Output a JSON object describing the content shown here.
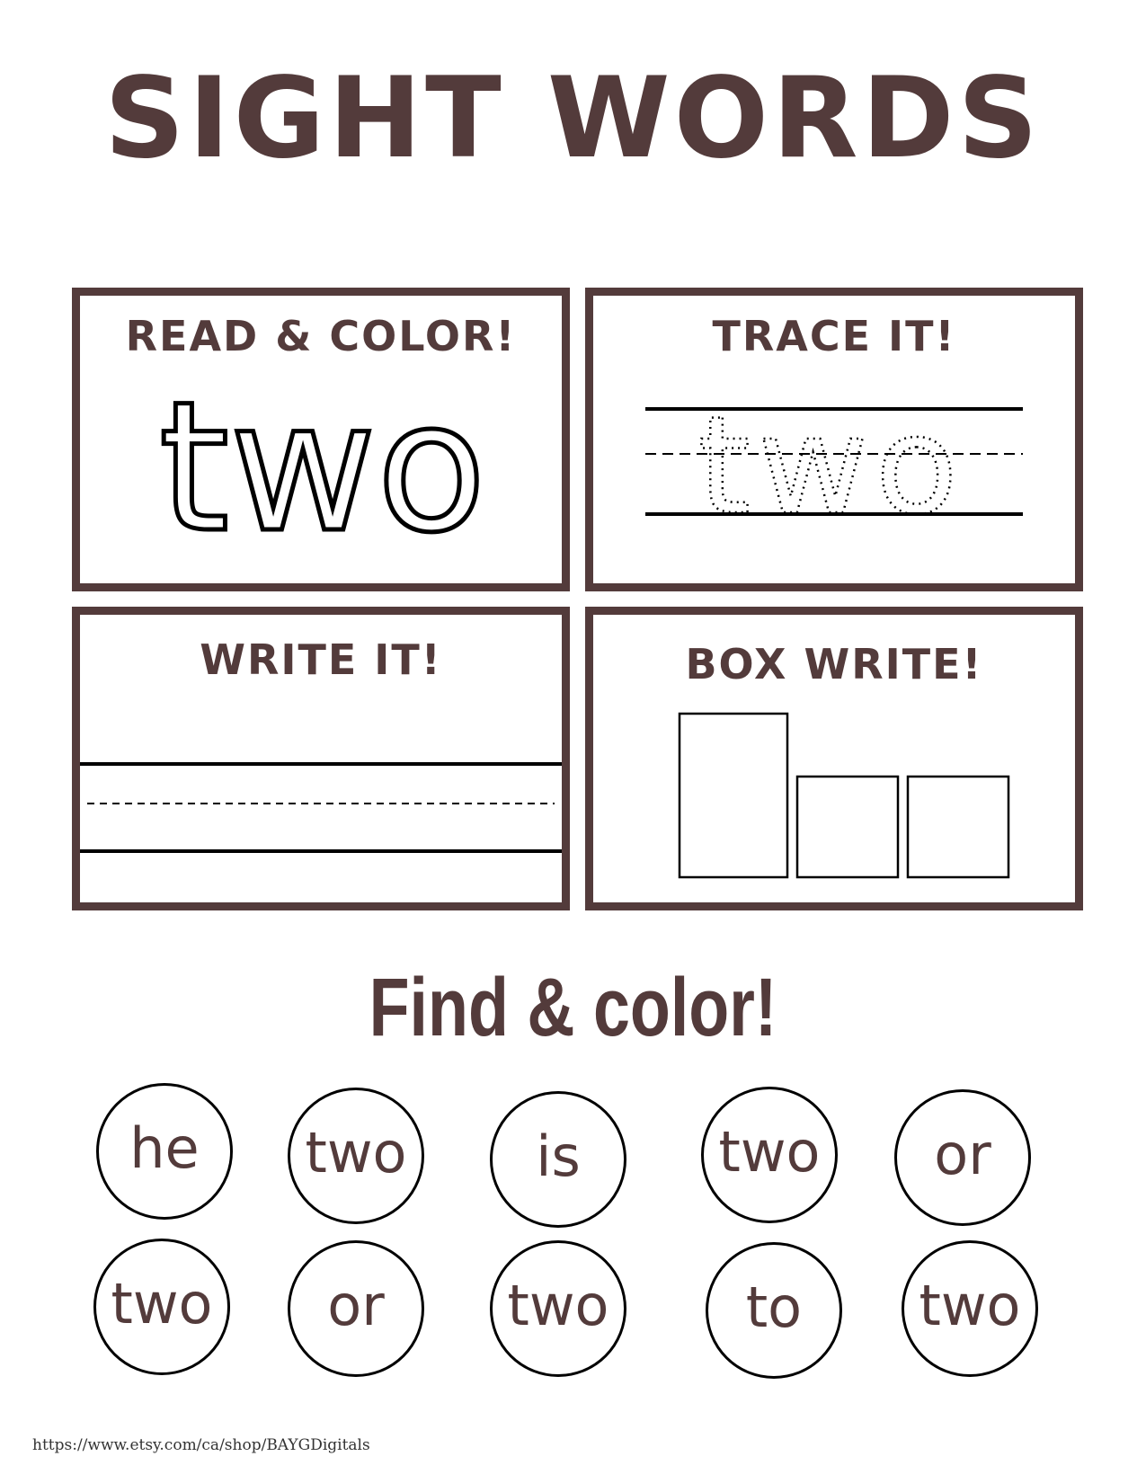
{
  "title": "SIGHT WORDS",
  "sight_word": "two",
  "panels": {
    "read": {
      "heading": "READ & COLOR!"
    },
    "trace": {
      "heading": "TRACE IT!"
    },
    "write": {
      "heading": "WRITE IT!"
    },
    "box": {
      "heading": "BOX WRITE!"
    }
  },
  "find": {
    "heading": "Find & color!",
    "words": [
      "he",
      "two",
      "is",
      "two",
      "or",
      "two",
      "or",
      "two",
      "to",
      "two"
    ]
  },
  "footer": {
    "url": "https://www.etsy.com/ca/shop/BAYGDigitals"
  },
  "colors": {
    "brand": "#533b3b",
    "line": "#000000",
    "background": "#ffffff"
  }
}
